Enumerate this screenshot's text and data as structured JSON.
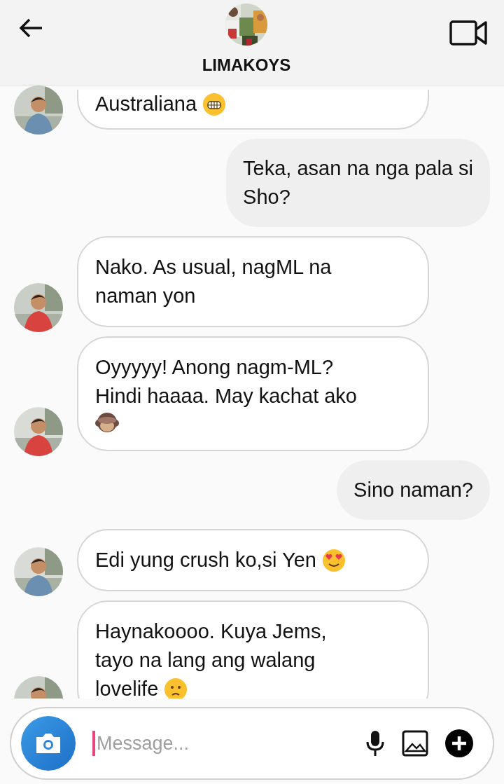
{
  "header": {
    "title": "LIMAKOYS"
  },
  "messages": [
    {
      "kind": "received",
      "lines": [
        {
          "text": "Australiana",
          "emoji": {
            "kind": "grin"
          }
        }
      ]
    },
    {
      "kind": "sent",
      "lines": [
        "Teka, asan na nga pala si",
        "Sho?"
      ]
    },
    {
      "kind": "received",
      "lines": [
        {
          "text": "Nako. As usual, nagML na"
        },
        {
          "text": "naman yon"
        }
      ]
    },
    {
      "kind": "received",
      "lines": [
        {
          "text": "Oyyyyy! Anong nagm-ML?"
        },
        {
          "text": "Hindi haaaa. May kachat ako"
        },
        {
          "emoji": {
            "kind": "monkey"
          }
        }
      ]
    },
    {
      "kind": "sent",
      "lines": [
        "Sino naman?"
      ]
    },
    {
      "kind": "received",
      "lines": [
        {
          "text": "Edi yung crush ko,si Yen",
          "emoji": {
            "kind": "hearts"
          }
        }
      ]
    },
    {
      "kind": "received",
      "lines": [
        {
          "text": "Haynakoooo. Kuya Jems,"
        },
        {
          "text": "tayo na lang ang walang"
        },
        {
          "text": "lovelife",
          "emoji": {
            "kind": "sad"
          }
        }
      ]
    }
  ],
  "composer": {
    "placeholder": "Message..."
  }
}
